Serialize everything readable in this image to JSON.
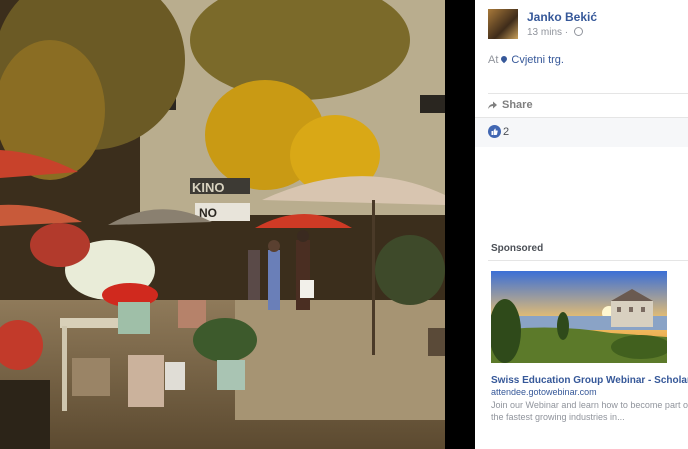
{
  "post": {
    "author": "Janko Bekić",
    "time": "13 mins",
    "separator": "·",
    "location_prefix": "At",
    "location": "Cvjetni trg."
  },
  "photo": {
    "sign_text": "KINO",
    "sign_text_2": "NO"
  },
  "actions": {
    "share_label": "Share"
  },
  "reactions": {
    "like_count": "2"
  },
  "sidebar": {
    "sponsored_label": "Sponsored"
  },
  "ad": {
    "title": "Swiss Education Group Webinar - Scholarships",
    "domain": "attendee.gotowebinar.com",
    "description_line1": "Join our Webinar and learn how to become part of",
    "description_line2": "the fastest growing industries in..."
  },
  "colors": {
    "link": "#365899",
    "muted": "#90949c",
    "like_blue": "#4267b2"
  },
  "icons": [
    "globe-icon",
    "location-pin-icon",
    "share-icon",
    "like-icon"
  ]
}
